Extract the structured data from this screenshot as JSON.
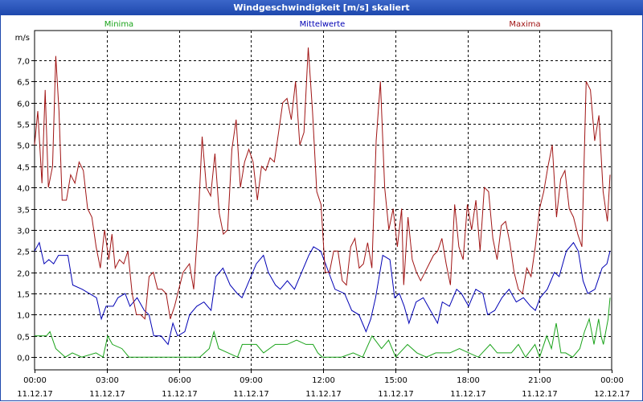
{
  "window": {
    "title": "Windgeschwindigkeit [m/s] skaliert"
  },
  "colors": {
    "minima": "#1aa31a",
    "mittelwerte": "#0000b4",
    "maxima": "#a01414",
    "grid": "#000000"
  },
  "chart_data": {
    "type": "line",
    "title": "Windgeschwindigkeit [m/s] skaliert",
    "ylabel": "m/s",
    "ylim": [
      -0.3,
      7.7
    ],
    "xlim": [
      0,
      24
    ],
    "y_ticks": [
      "0,0",
      "0,5",
      "1,0",
      "1,5",
      "2,0",
      "2,5",
      "3,0",
      "3,5",
      "4,0",
      "4,5",
      "5,0",
      "5,5",
      "6,0",
      "6,5",
      "7,0"
    ],
    "x_ticks": [
      {
        "time": "00:00",
        "date": "11.12.17"
      },
      {
        "time": "03:00",
        "date": "11.12.17"
      },
      {
        "time": "06:00",
        "date": "11.12.17"
      },
      {
        "time": "09:00",
        "date": "11.12.17"
      },
      {
        "time": "12:00",
        "date": "11.12.17"
      },
      {
        "time": "15:00",
        "date": "11.12.17"
      },
      {
        "time": "18:00",
        "date": "11.12.17"
      },
      {
        "time": "21:00",
        "date": "11.12.17"
      },
      {
        "time": "00:00",
        "date": "12.12.17"
      }
    ],
    "grid": true,
    "series": [
      {
        "name": "Minima",
        "color": "#1aa31a",
        "legend_position": "left",
        "values": [
          [
            0.0,
            0.5
          ],
          [
            0.5,
            0.5
          ],
          [
            0.65,
            0.6
          ],
          [
            0.9,
            0.2
          ],
          [
            1.3,
            0.0
          ],
          [
            1.6,
            0.1
          ],
          [
            2.0,
            0.0
          ],
          [
            2.6,
            0.1
          ],
          [
            2.9,
            0.0
          ],
          [
            3.1,
            0.5
          ],
          [
            3.3,
            0.3
          ],
          [
            3.7,
            0.2
          ],
          [
            4.0,
            0.0
          ],
          [
            5.0,
            0.0
          ],
          [
            6.0,
            0.0
          ],
          [
            7.0,
            0.0
          ],
          [
            7.4,
            0.2
          ],
          [
            7.6,
            0.6
          ],
          [
            7.8,
            0.2
          ],
          [
            8.2,
            0.1
          ],
          [
            8.6,
            0.0
          ],
          [
            8.8,
            0.3
          ],
          [
            9.4,
            0.3
          ],
          [
            9.7,
            0.1
          ],
          [
            10.2,
            0.3
          ],
          [
            10.7,
            0.3
          ],
          [
            11.1,
            0.4
          ],
          [
            11.5,
            0.3
          ],
          [
            11.8,
            0.3
          ],
          [
            12.0,
            0.1
          ],
          [
            12.2,
            0.0
          ],
          [
            13.0,
            0.0
          ],
          [
            13.5,
            0.1
          ],
          [
            13.9,
            0.0
          ],
          [
            14.3,
            0.5
          ],
          [
            14.7,
            0.2
          ],
          [
            15.0,
            0.4
          ],
          [
            15.3,
            0.0
          ],
          [
            15.8,
            0.3
          ],
          [
            16.2,
            0.1
          ],
          [
            16.6,
            0.0
          ],
          [
            17.0,
            0.1
          ],
          [
            17.6,
            0.1
          ],
          [
            18.0,
            0.2
          ],
          [
            18.4,
            0.1
          ],
          [
            18.8,
            0.0
          ],
          [
            19.3,
            0.3
          ],
          [
            19.6,
            0.1
          ],
          [
            20.2,
            0.1
          ],
          [
            20.5,
            0.3
          ],
          [
            20.8,
            0.0
          ],
          [
            21.2,
            0.3
          ],
          [
            21.4,
            0.0
          ],
          [
            21.7,
            0.5
          ],
          [
            21.9,
            0.2
          ],
          [
            22.1,
            0.8
          ],
          [
            22.3,
            0.1
          ],
          [
            22.5,
            0.1
          ],
          [
            22.8,
            0.0
          ],
          [
            23.1,
            0.2
          ],
          [
            23.3,
            0.6
          ],
          [
            23.5,
            0.9
          ],
          [
            23.7,
            0.3
          ],
          [
            23.9,
            0.9
          ],
          [
            24.0,
            0.5
          ],
          [
            24.1,
            0.3
          ],
          [
            24.3,
            0.9
          ],
          [
            24.45,
            1.4
          ]
        ]
      },
      {
        "name": "Mittelwerte",
        "color": "#0000b4",
        "legend_position": "center",
        "values": [
          [
            0.0,
            2.5
          ],
          [
            0.2,
            2.7
          ],
          [
            0.4,
            2.2
          ],
          [
            0.6,
            2.3
          ],
          [
            0.8,
            2.2
          ],
          [
            1.0,
            2.4
          ],
          [
            1.4,
            2.4
          ],
          [
            1.6,
            1.7
          ],
          [
            2.0,
            1.6
          ],
          [
            2.3,
            1.5
          ],
          [
            2.6,
            1.4
          ],
          [
            2.8,
            0.9
          ],
          [
            3.0,
            1.2
          ],
          [
            3.3,
            1.2
          ],
          [
            3.5,
            1.4
          ],
          [
            3.8,
            1.5
          ],
          [
            4.0,
            1.2
          ],
          [
            4.3,
            1.4
          ],
          [
            4.6,
            1.1
          ],
          [
            4.8,
            1.0
          ],
          [
            5.0,
            0.5
          ],
          [
            5.3,
            0.5
          ],
          [
            5.6,
            0.3
          ],
          [
            5.8,
            0.8
          ],
          [
            6.0,
            0.5
          ],
          [
            6.3,
            0.6
          ],
          [
            6.5,
            1.0
          ],
          [
            6.8,
            1.2
          ],
          [
            7.1,
            1.3
          ],
          [
            7.4,
            1.1
          ],
          [
            7.6,
            1.9
          ],
          [
            7.9,
            2.1
          ],
          [
            8.2,
            1.7
          ],
          [
            8.5,
            1.5
          ],
          [
            8.7,
            1.4
          ],
          [
            9.0,
            1.8
          ],
          [
            9.3,
            2.2
          ],
          [
            9.6,
            2.4
          ],
          [
            9.8,
            2.0
          ],
          [
            10.1,
            1.7
          ],
          [
            10.3,
            1.6
          ],
          [
            10.6,
            1.8
          ],
          [
            10.9,
            1.6
          ],
          [
            11.2,
            2.0
          ],
          [
            11.5,
            2.4
          ],
          [
            11.7,
            2.6
          ],
          [
            12.0,
            2.5
          ],
          [
            12.2,
            2.2
          ],
          [
            12.4,
            1.9
          ],
          [
            12.6,
            1.6
          ],
          [
            13.0,
            1.5
          ],
          [
            13.3,
            1.1
          ],
          [
            13.6,
            1.0
          ],
          [
            13.9,
            0.6
          ],
          [
            14.1,
            0.9
          ],
          [
            14.3,
            1.4
          ],
          [
            14.6,
            2.4
          ],
          [
            14.9,
            2.3
          ],
          [
            15.1,
            1.4
          ],
          [
            15.3,
            1.5
          ],
          [
            15.5,
            1.2
          ],
          [
            15.7,
            0.8
          ],
          [
            16.0,
            1.3
          ],
          [
            16.3,
            1.4
          ],
          [
            16.6,
            1.1
          ],
          [
            16.9,
            0.8
          ],
          [
            17.1,
            1.3
          ],
          [
            17.4,
            1.2
          ],
          [
            17.7,
            1.6
          ],
          [
            17.9,
            1.5
          ],
          [
            18.2,
            1.2
          ],
          [
            18.5,
            1.6
          ],
          [
            18.8,
            1.5
          ],
          [
            19.0,
            1.0
          ],
          [
            19.3,
            1.1
          ],
          [
            19.6,
            1.4
          ],
          [
            19.9,
            1.6
          ],
          [
            20.2,
            1.3
          ],
          [
            20.5,
            1.4
          ],
          [
            20.8,
            1.2
          ],
          [
            21.0,
            1.1
          ],
          [
            21.2,
            1.4
          ],
          [
            21.5,
            1.6
          ],
          [
            21.8,
            2.0
          ],
          [
            22.0,
            1.9
          ],
          [
            22.3,
            2.5
          ],
          [
            22.6,
            2.7
          ],
          [
            22.8,
            2.5
          ],
          [
            23.0,
            1.8
          ],
          [
            23.2,
            1.5
          ],
          [
            23.5,
            1.6
          ],
          [
            23.8,
            2.1
          ],
          [
            24.0,
            2.2
          ],
          [
            24.2,
            2.5
          ]
        ]
      },
      {
        "name": "Maxima",
        "color": "#a01414",
        "legend_position": "right",
        "values": [
          [
            0.0,
            5.0
          ],
          [
            0.15,
            5.8
          ],
          [
            0.35,
            4.1
          ],
          [
            0.5,
            6.3
          ],
          [
            0.65,
            4.0
          ],
          [
            0.85,
            4.5
          ],
          [
            1.0,
            7.1
          ],
          [
            1.15,
            5.8
          ],
          [
            1.3,
            3.7
          ],
          [
            1.5,
            3.7
          ],
          [
            1.7,
            4.3
          ],
          [
            1.9,
            4.1
          ],
          [
            2.1,
            4.6
          ],
          [
            2.3,
            4.4
          ],
          [
            2.5,
            3.5
          ],
          [
            2.7,
            3.3
          ],
          [
            2.9,
            2.6
          ],
          [
            3.1,
            2.1
          ],
          [
            3.3,
            3.0
          ],
          [
            3.5,
            2.3
          ],
          [
            3.65,
            2.9
          ],
          [
            3.8,
            2.1
          ],
          [
            4.0,
            2.3
          ],
          [
            4.2,
            2.2
          ],
          [
            4.4,
            2.5
          ],
          [
            4.6,
            1.5
          ],
          [
            4.8,
            1.0
          ],
          [
            5.0,
            1.0
          ],
          [
            5.2,
            0.9
          ],
          [
            5.4,
            1.9
          ],
          [
            5.6,
            2.0
          ],
          [
            5.8,
            1.6
          ],
          [
            6.0,
            1.6
          ],
          [
            6.2,
            1.5
          ],
          [
            6.4,
            0.9
          ],
          [
            6.6,
            1.2
          ],
          [
            6.8,
            1.6
          ],
          [
            7.0,
            2.0
          ],
          [
            7.3,
            2.2
          ],
          [
            7.5,
            1.6
          ],
          [
            7.7,
            3.1
          ],
          [
            7.9,
            5.2
          ],
          [
            8.1,
            4.0
          ],
          [
            8.3,
            3.8
          ],
          [
            8.5,
            4.8
          ],
          [
            8.7,
            3.4
          ],
          [
            8.9,
            2.9
          ],
          [
            9.1,
            3.0
          ],
          [
            9.3,
            4.9
          ],
          [
            9.5,
            5.6
          ],
          [
            9.7,
            4.0
          ],
          [
            9.9,
            4.6
          ],
          [
            10.1,
            4.9
          ],
          [
            10.3,
            4.6
          ],
          [
            10.5,
            3.7
          ],
          [
            10.7,
            4.5
          ],
          [
            10.9,
            4.4
          ],
          [
            11.1,
            4.7
          ],
          [
            11.3,
            4.6
          ],
          [
            11.5,
            5.3
          ],
          [
            11.7,
            6.0
          ],
          [
            11.9,
            6.1
          ],
          [
            12.1,
            5.6
          ],
          [
            12.3,
            6.5
          ],
          [
            12.5,
            5.0
          ],
          [
            12.7,
            5.3
          ],
          [
            12.9,
            7.3
          ],
          [
            13.1,
            5.8
          ],
          [
            13.3,
            3.9
          ],
          [
            13.5,
            3.6
          ],
          [
            13.7,
            2.0
          ],
          [
            13.9,
            2.0
          ],
          [
            14.1,
            2.5
          ],
          [
            14.3,
            2.5
          ],
          [
            14.5,
            1.8
          ],
          [
            14.7,
            1.7
          ],
          [
            14.9,
            2.6
          ],
          [
            15.1,
            2.8
          ],
          [
            15.3,
            2.1
          ],
          [
            15.5,
            2.2
          ],
          [
            15.7,
            2.7
          ],
          [
            15.9,
            2.1
          ],
          [
            16.1,
            5.1
          ],
          [
            16.3,
            6.5
          ],
          [
            16.5,
            4.0
          ],
          [
            16.7,
            3.0
          ],
          [
            16.9,
            3.5
          ],
          [
            17.1,
            2.6
          ],
          [
            17.3,
            3.5
          ],
          [
            17.4,
            1.7
          ],
          [
            17.6,
            3.3
          ],
          [
            17.8,
            2.3
          ],
          [
            18.0,
            2.0
          ],
          [
            18.2,
            1.8
          ],
          [
            18.4,
            2.0
          ],
          [
            18.6,
            2.2
          ],
          [
            18.8,
            2.4
          ],
          [
            19.0,
            2.5
          ],
          [
            19.2,
            2.8
          ],
          [
            19.4,
            2.2
          ],
          [
            19.6,
            1.7
          ],
          [
            19.8,
            3.6
          ],
          [
            20.0,
            2.6
          ],
          [
            20.2,
            2.3
          ],
          [
            20.4,
            3.6
          ],
          [
            20.6,
            3.0
          ],
          [
            20.8,
            3.7
          ],
          [
            21.0,
            2.5
          ],
          [
            21.2,
            4.0
          ],
          [
            21.4,
            3.9
          ],
          [
            21.6,
            2.8
          ],
          [
            21.8,
            2.3
          ],
          [
            22.0,
            3.1
          ],
          [
            22.2,
            3.2
          ],
          [
            22.4,
            2.7
          ],
          [
            22.6,
            2.0
          ],
          [
            22.8,
            1.6
          ],
          [
            23.0,
            1.5
          ],
          [
            23.2,
            2.1
          ],
          [
            23.4,
            1.9
          ],
          [
            23.6,
            2.6
          ],
          [
            23.8,
            3.5
          ],
          [
            24.0,
            3.9
          ],
          [
            24.2,
            4.5
          ],
          [
            24.4,
            5.0
          ],
          [
            24.6,
            3.3
          ],
          [
            24.8,
            4.2
          ],
          [
            25.0,
            4.4
          ],
          [
            25.2,
            3.5
          ],
          [
            25.4,
            3.3
          ],
          [
            25.6,
            2.9
          ],
          [
            25.8,
            2.6
          ],
          [
            26.0,
            6.5
          ],
          [
            26.2,
            6.3
          ],
          [
            26.4,
            5.1
          ],
          [
            26.6,
            5.7
          ],
          [
            26.8,
            3.9
          ],
          [
            27.0,
            3.2
          ],
          [
            27.2,
            4.3
          ]
        ]
      }
    ]
  }
}
